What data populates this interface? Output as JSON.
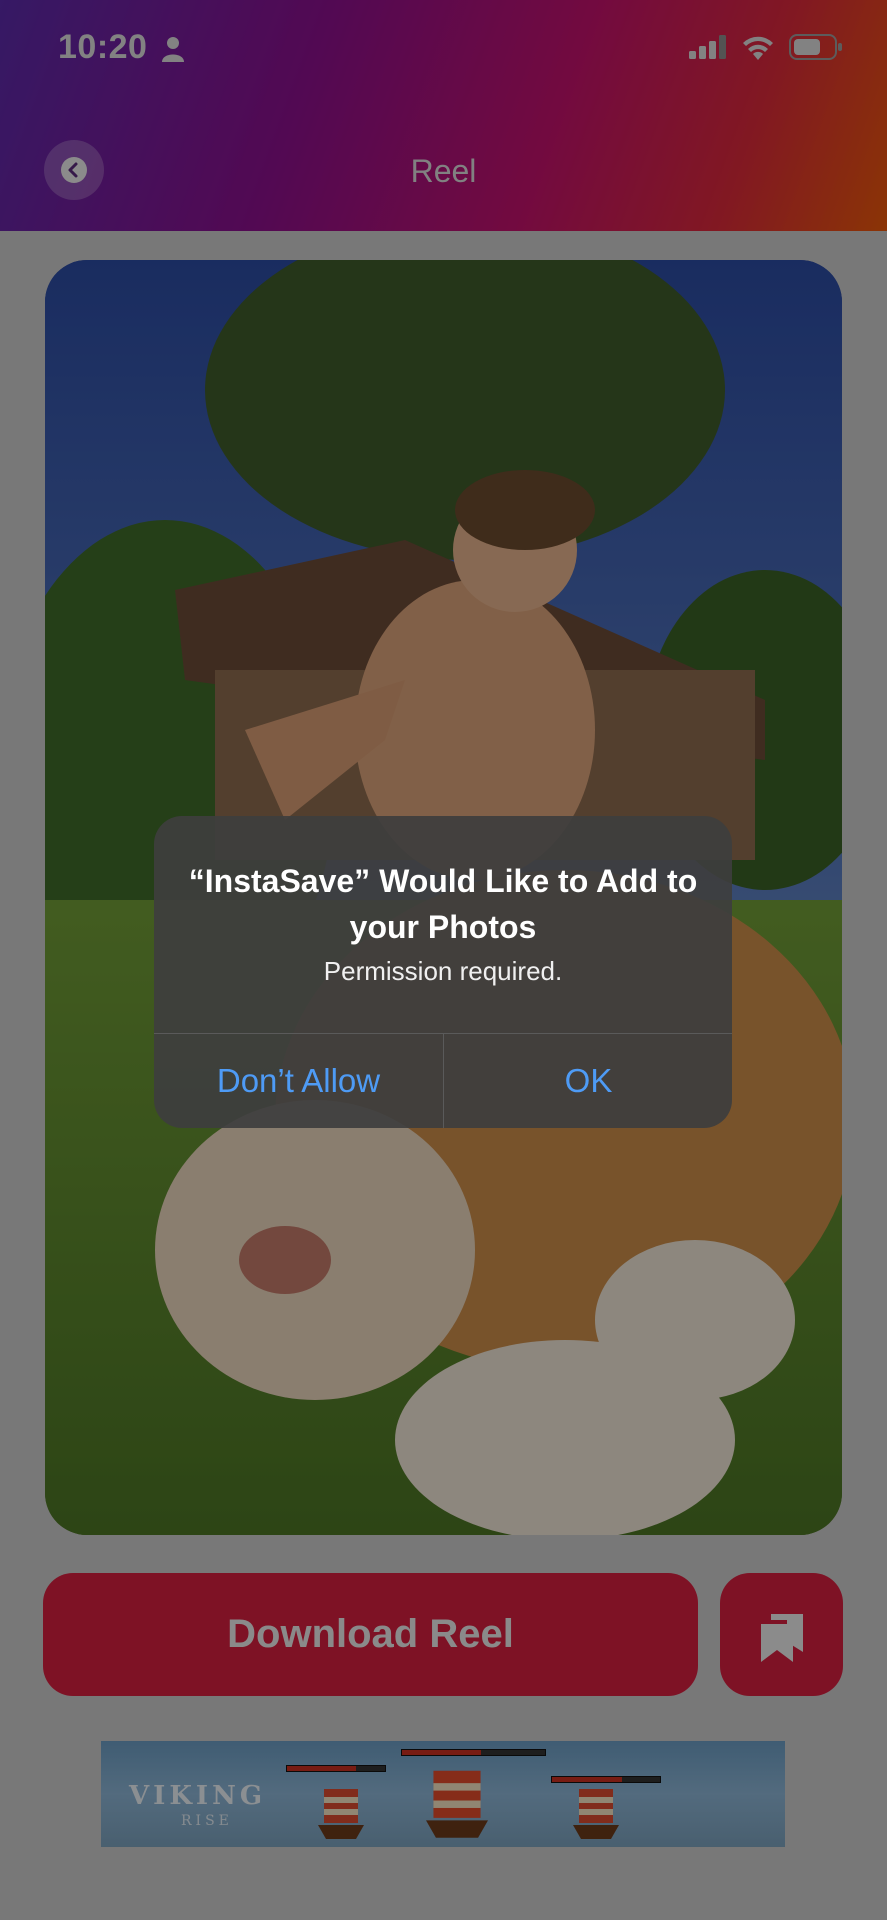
{
  "status_bar": {
    "time": "10:20"
  },
  "header": {
    "title": "Reel",
    "back_icon": "chevron-left-icon",
    "gradient_colors": [
      "#5a2aa8",
      "#8a0f8a",
      "#c0126a",
      "#d8283a",
      "#e8580a"
    ]
  },
  "actions": {
    "download_label": "Download Reel",
    "share_icon": "copy-bookmark-icon",
    "accent_color": "#d31f3e"
  },
  "ad": {
    "logo": "VIKING",
    "logo_sub": "RISE"
  },
  "alert": {
    "title": "“InstaSave” Would Like to Add to your Photos",
    "message": "Permission required.",
    "deny_label": "Don’t Allow",
    "ok_label": "OK",
    "button_color": "#4e9bf5"
  }
}
